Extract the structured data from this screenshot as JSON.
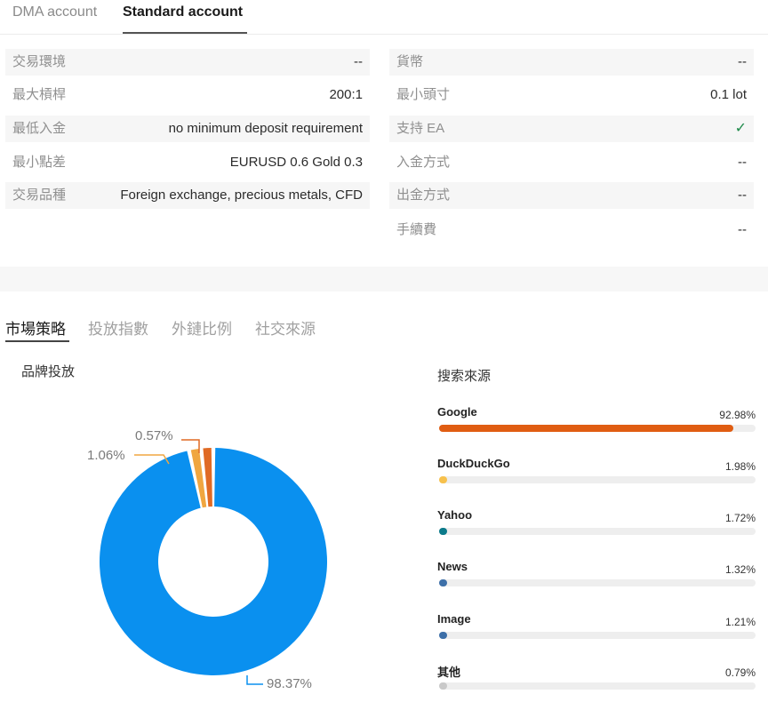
{
  "account_tabs": [
    "DMA account",
    "Standard account"
  ],
  "specs_left": [
    {
      "label": "交易環境",
      "value": "--"
    },
    {
      "label": "最大槓桿",
      "value": "200:1"
    },
    {
      "label": "最低入金",
      "value": "no minimum deposit requirement"
    },
    {
      "label": "最小點差",
      "value": "EURUSD 0.6 Gold 0.3"
    },
    {
      "label": "交易品種",
      "value": "Foreign exchange, precious metals, CFD"
    }
  ],
  "specs_right": [
    {
      "label": "貨幣",
      "value": "--"
    },
    {
      "label": "最小頭寸",
      "value": "0.1 lot"
    },
    {
      "label": "支持 EA",
      "value": "✓"
    },
    {
      "label": "入金方式",
      "value": "--"
    },
    {
      "label": "出金方式",
      "value": "--"
    },
    {
      "label": "手續費",
      "value": "--"
    }
  ],
  "market_tabs": [
    "市場策略",
    "投放指數",
    "外鏈比例",
    "社交來源"
  ],
  "brand_title": "品牌投放",
  "search_title": "搜索來源",
  "colors": {
    "blue": "#0a90ef",
    "orange_light": "#f0a640",
    "orange_dark": "#e06a24"
  },
  "chart_data": {
    "type": "pie",
    "title": "品牌投放",
    "slices": [
      {
        "value": 98.37,
        "label": "98.37%",
        "color": "#0a90ef"
      },
      {
        "value": 1.06,
        "label": "1.06%",
        "color": "#f0a640"
      },
      {
        "value": 0.57,
        "label": "0.57%",
        "color": "#e06a24"
      }
    ]
  },
  "search_sources": [
    {
      "name": "Google",
      "percent_label": "92.98%",
      "value": 92.98,
      "color": "#e05d12"
    },
    {
      "name": "DuckDuckGo",
      "percent_label": "1.98%",
      "value": 1.98,
      "color": "#f7c14c"
    },
    {
      "name": "Yahoo",
      "percent_label": "1.72%",
      "value": 1.72,
      "color": "#0b7a8a"
    },
    {
      "name": "News",
      "percent_label": "1.32%",
      "value": 1.32,
      "color": "#3d6fa8"
    },
    {
      "name": "Image",
      "percent_label": "1.21%",
      "value": 1.21,
      "color": "#3d6fa8"
    },
    {
      "name": "其他",
      "percent_label": "0.79%",
      "value": 0.79,
      "color": "#c9c9c9"
    }
  ]
}
